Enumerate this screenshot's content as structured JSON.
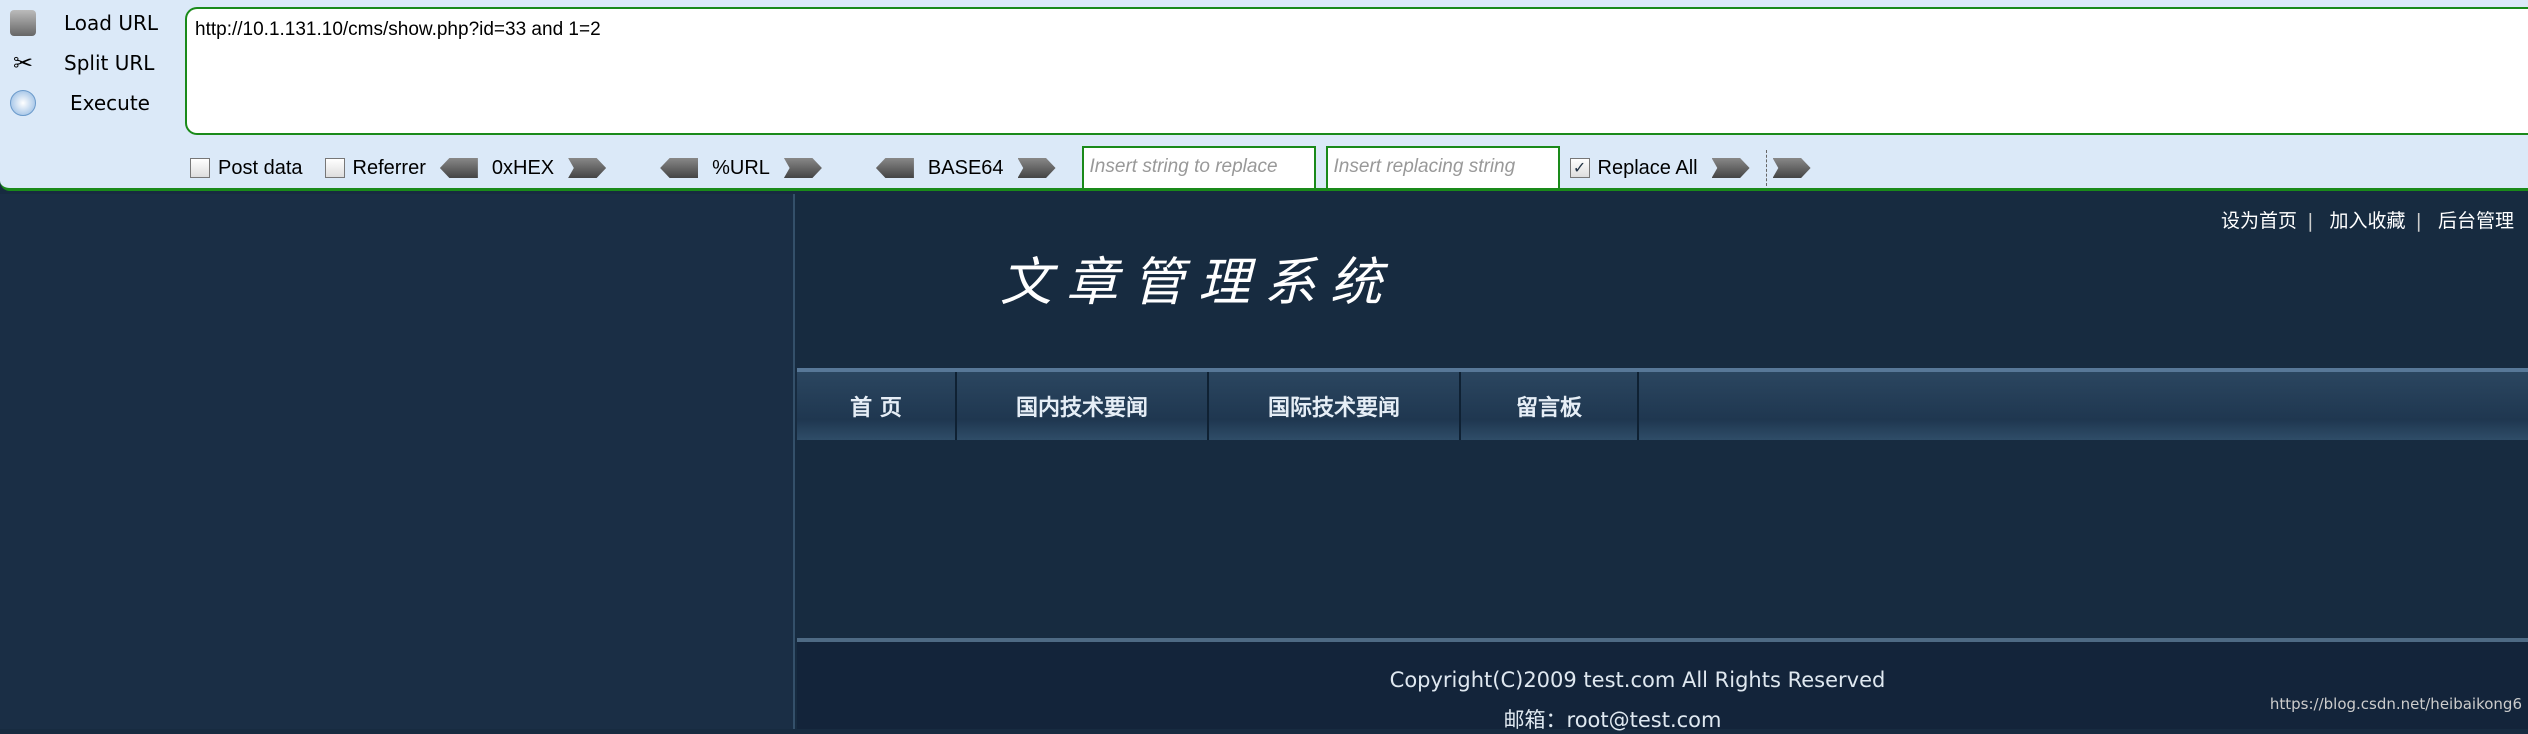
{
  "toolbar": {
    "load_url": "Load URL",
    "split_url": "Split URL",
    "execute": "Execute",
    "url": "http://10.1.131.10/cms/show.php?id=33 and 1=2",
    "post_data": "Post data",
    "referrer": "Referrer",
    "hex": "0xHEX",
    "urlenc": "%URL",
    "base64": "BASE64",
    "find_placeholder": "Insert string to replace",
    "replace_placeholder": "Insert replacing string",
    "replace_all": "Replace All",
    "replace_all_checked": true,
    "accent": "#1a8a1a"
  },
  "site": {
    "top_links": [
      "设为首页",
      "加入收藏",
      "后台管理"
    ],
    "title": "文章管理系统",
    "nav": [
      "首 页",
      "国内技术要闻",
      "国际技术要闻",
      "留言板"
    ],
    "copyright": "Copyright(C)2009 test.com All Rights Reserved",
    "email": "邮箱：root@test.com",
    "watermark": "https://blog.csdn.net/heibaikong6"
  }
}
